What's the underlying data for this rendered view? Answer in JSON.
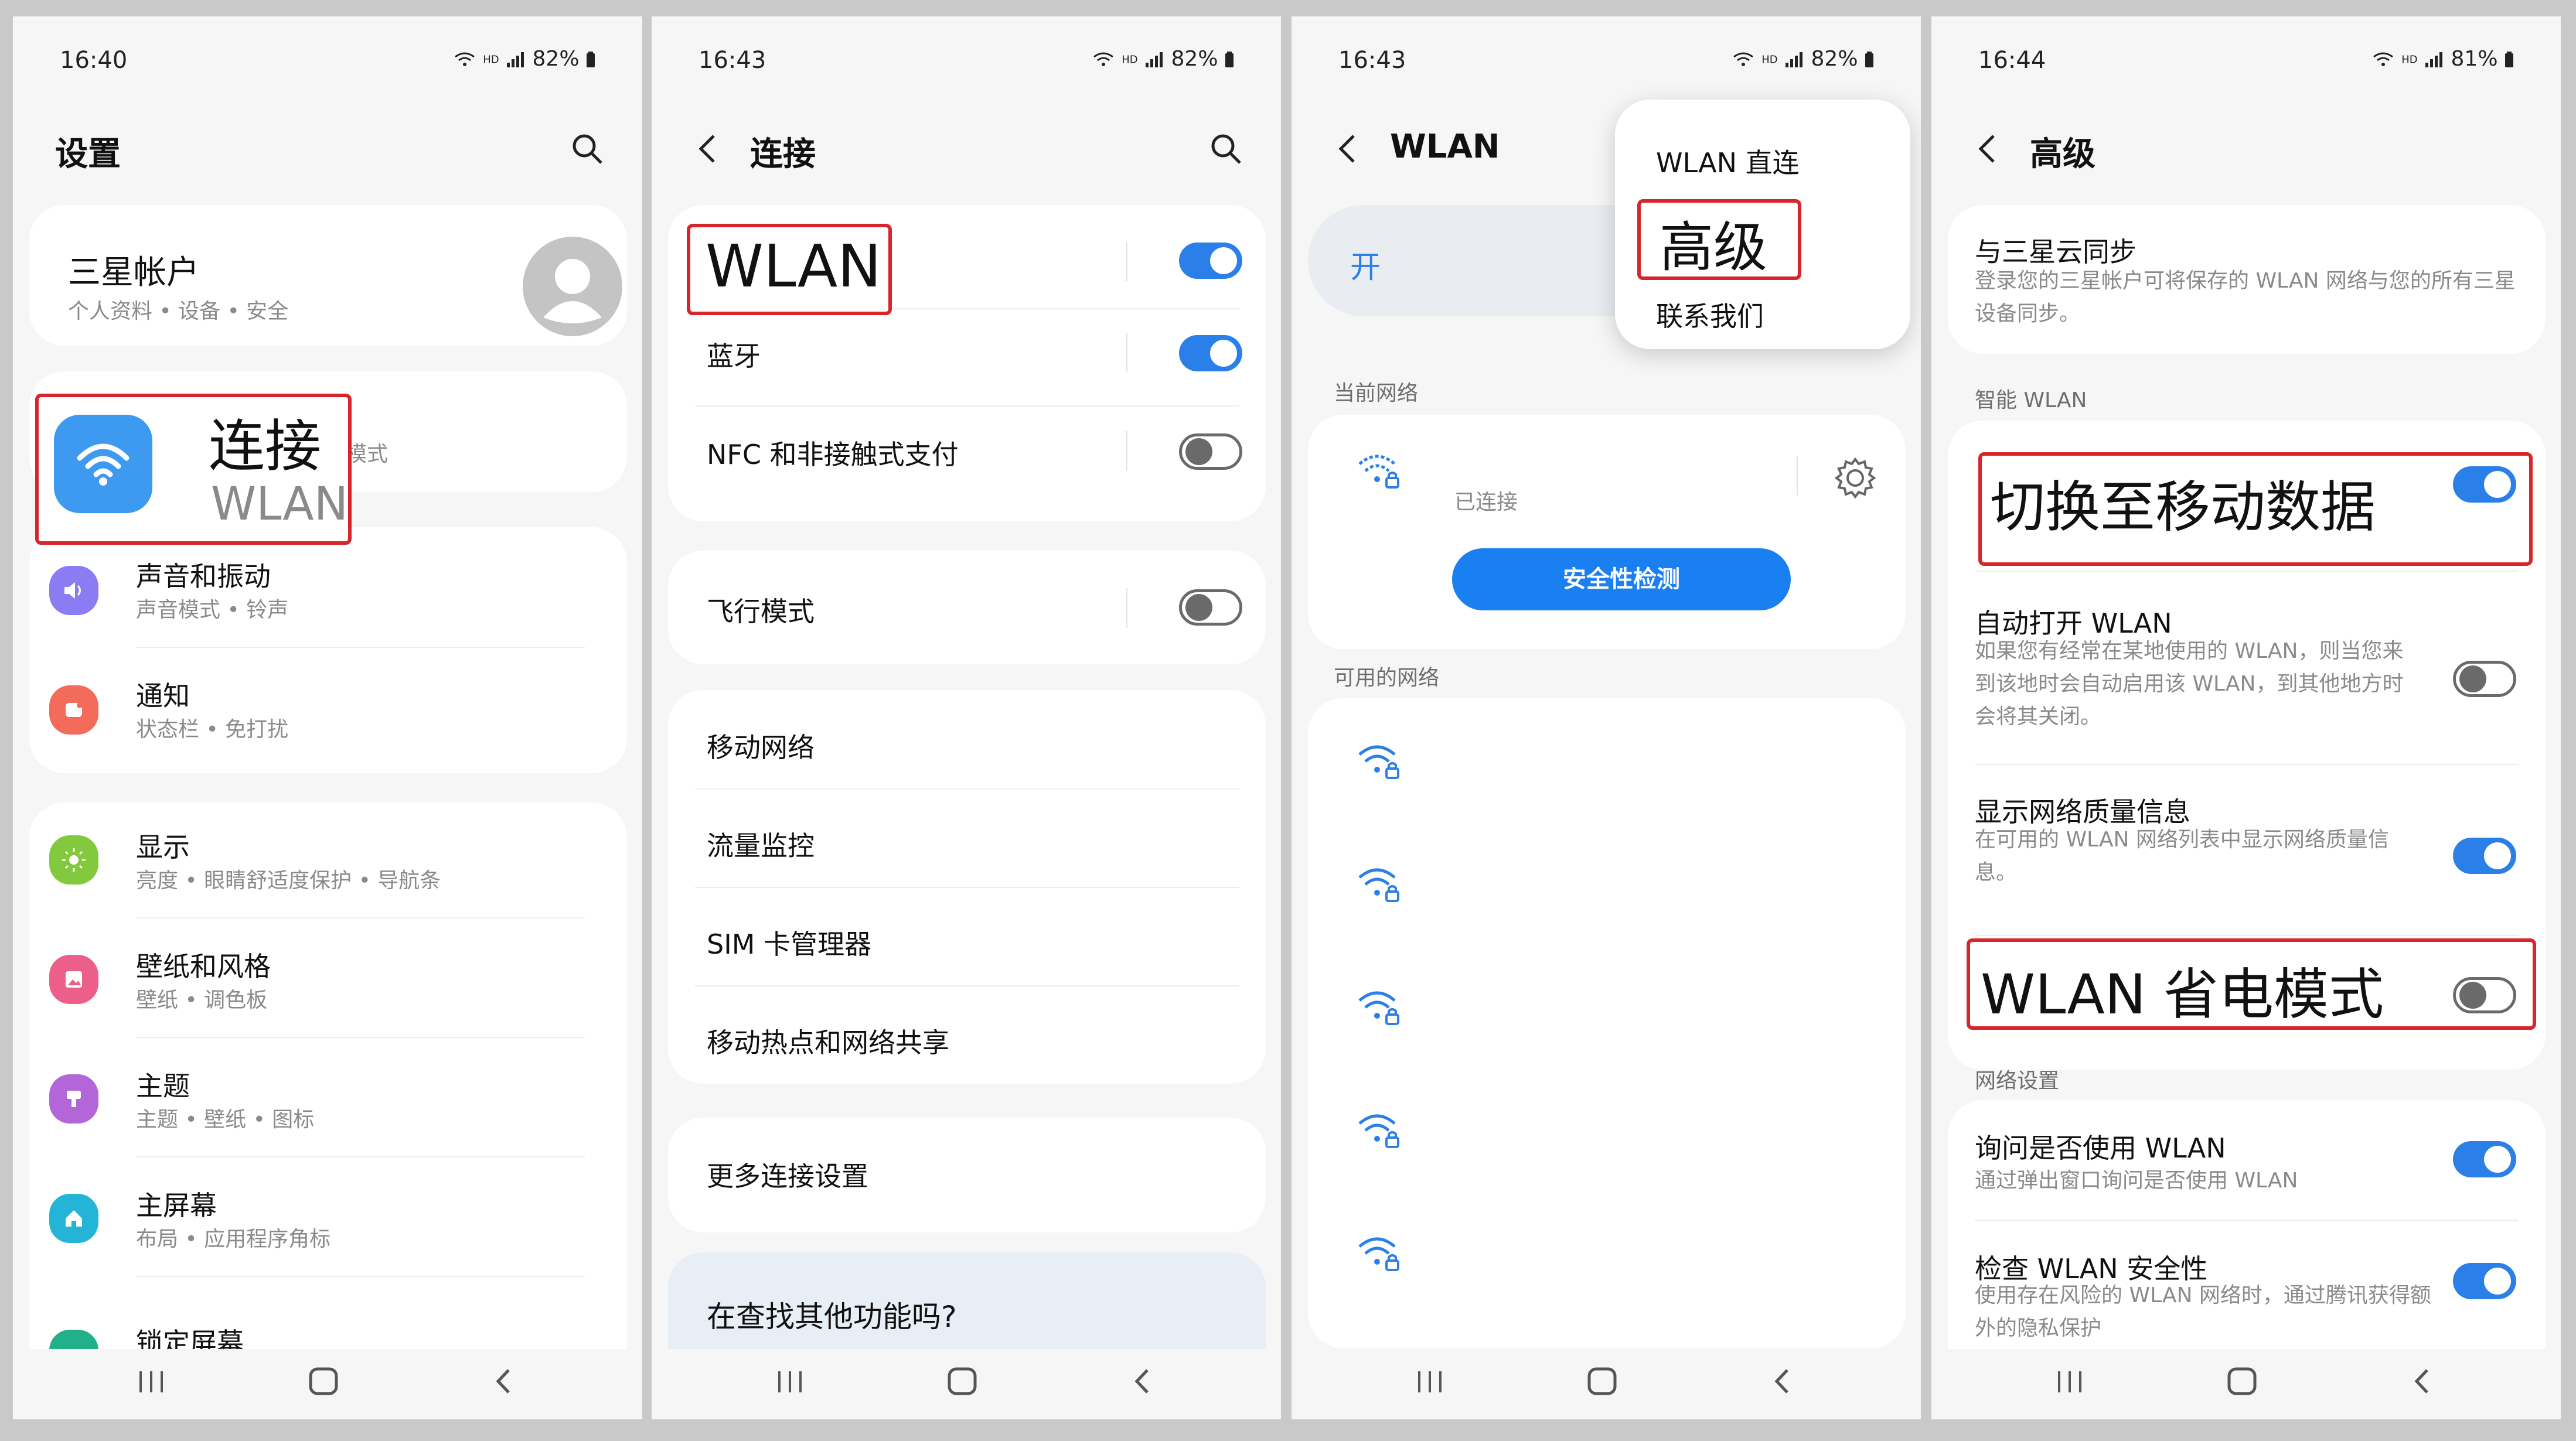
{
  "status": {
    "p1": {
      "time": "16:40",
      "battery": "82%"
    },
    "p2": {
      "time": "16:43",
      "battery": "82%"
    },
    "p3": {
      "time": "16:43",
      "battery": "82%"
    },
    "p4": {
      "time": "16:44",
      "battery": "81%"
    }
  },
  "panel1": {
    "title": "设置",
    "account": {
      "title": "三星帐户",
      "subtitle": "个人资料 • 设备 • 安全"
    },
    "connect": {
      "label": "连接",
      "sub": "WLAN",
      "peek": "模式"
    },
    "items": [
      {
        "title": "声音和振动",
        "subtitle": "声音模式 • 铃声",
        "icon": "volume-icon",
        "color": "#8b7cf4"
      },
      {
        "title": "通知",
        "subtitle": "状态栏 • 免打扰",
        "icon": "notification-icon",
        "color": "#f36b5a"
      },
      {
        "title": "显示",
        "subtitle": "亮度 • 眼睛舒适度保护 • 导航条",
        "icon": "brightness-icon",
        "color": "#82c93d"
      },
      {
        "title": "壁纸和风格",
        "subtitle": "壁纸 • 调色板",
        "icon": "wallpaper-icon",
        "color": "#ec5f8b"
      },
      {
        "title": "主题",
        "subtitle": "主题 • 壁纸 • 图标",
        "icon": "themes-icon",
        "color": "#b266d8"
      },
      {
        "title": "主屏幕",
        "subtitle": "布局 • 应用程序角标",
        "icon": "home-icon",
        "color": "#24b4d8"
      },
      {
        "title": "锁定屏幕",
        "subtitle": "",
        "icon": "lock-icon",
        "color": "#21b08a"
      }
    ]
  },
  "panel2": {
    "title": "连接",
    "wlan": "WLAN",
    "bluetooth": "蓝牙",
    "nfc": "NFC 和非接触式支付",
    "airplane": "飞行模式",
    "mobile": "移动网络",
    "data_usage": "流量监控",
    "sim": "SIM 卡管理器",
    "hotspot": "移动热点和网络共享",
    "more": "更多连接设置",
    "looking": "在查找其他功能吗?"
  },
  "panel3": {
    "title": "WLAN",
    "on": "开",
    "menu": {
      "direct": "WLAN 直连",
      "advanced": "高级",
      "contact": "联系我们"
    },
    "current_section": "当前网络",
    "connected": "已连接",
    "security_btn": "安全性检测",
    "available_section": "可用的网络",
    "available_count": 5
  },
  "panel4": {
    "title": "高级",
    "sync": {
      "title": "与三星云同步",
      "desc": "登录您的三星帐户可将保存的 WLAN 网络与您的所有三星设备同步。"
    },
    "smart_section": "智能 WLAN",
    "switch_mobile": "切换至移动数据",
    "auto_on": {
      "title": "自动打开 WLAN",
      "desc": "如果您有经常在某地使用的 WLAN，则当您来到该地时会自动启用该 WLAN，到其他地方时会将其关闭。"
    },
    "quality": {
      "title": "显示网络质量信息",
      "desc": "在可用的 WLAN 网络列表中显示网络质量信息。"
    },
    "power_save": "WLAN 省电模式",
    "net_section": "网络设置",
    "ask": {
      "title": "询问是否使用 WLAN",
      "desc": "通过弹出窗口询问是否使用 WLAN"
    },
    "check": {
      "title": "检查 WLAN 安全性",
      "desc": "使用存在风险的 WLAN 网络时，通过腾讯获得额外的隐私保护"
    }
  },
  "colors": {
    "accent": "#2b7fe8",
    "highlight": "#d6262c",
    "button": "#1a7ff0"
  }
}
